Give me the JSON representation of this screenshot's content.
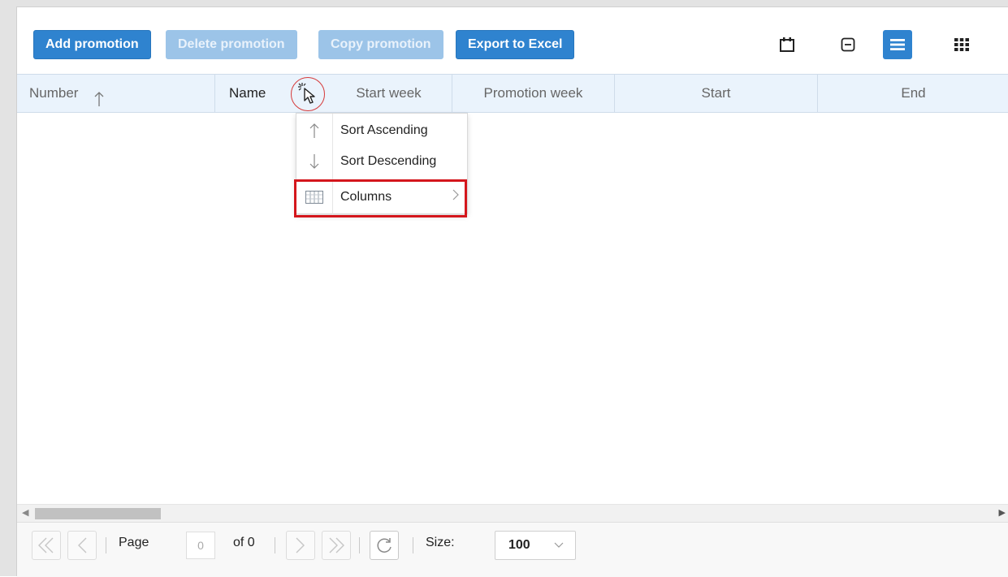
{
  "toolbar": {
    "add_label": "Add promotion",
    "delete_label": "Delete promotion",
    "copy_label": "Copy promotion",
    "export_label": "Export to Excel",
    "icons": [
      "calendar-icon",
      "collapse-icon",
      "list-view-icon",
      "grid-view-icon"
    ]
  },
  "columns": [
    {
      "label": "Number",
      "sorted": "ascending"
    },
    {
      "label": "Name"
    },
    {
      "label": "Start week"
    },
    {
      "label": "Promotion week"
    },
    {
      "label": "Start"
    },
    {
      "label": "End"
    }
  ],
  "column_menu": {
    "items": [
      {
        "label": "Sort Ascending",
        "icon": "arrow-up-icon"
      },
      {
        "label": "Sort Descending",
        "icon": "arrow-down-icon"
      },
      {
        "label": "Columns",
        "icon": "columns-icon",
        "has_submenu": true
      }
    ],
    "highlighted": "Columns"
  },
  "pager": {
    "page_label": "Page",
    "page_value": "0",
    "of_label": "of 0",
    "size_label": "Size:",
    "size_value": "100"
  },
  "colors": {
    "primary": "#2f83cf",
    "primary_disabled": "#9cc4e8",
    "header_bg": "#eaf3fc",
    "highlight": "#d4161c"
  }
}
